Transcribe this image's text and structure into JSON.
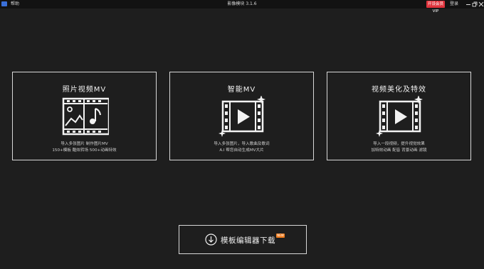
{
  "titlebar": {
    "menu_help": "帮助",
    "app_title": "影像模块 3.1.6",
    "upgrade_label": "开设会员VIP",
    "login_label": "登录"
  },
  "cards": [
    {
      "title": "照片视频MV",
      "desc1": "导入多张图片 制作图片MV",
      "desc2": "150+模板 酷炫转场 500+动画特效",
      "icon": "photo-music-icon"
    },
    {
      "title": "智能MV",
      "desc1": "导入多张图片，导入歌曲及歌词",
      "desc2": "A.I 帮您自动生成MV大片",
      "icon": "video-play-sparkle-icon"
    },
    {
      "title": "视频美化及特效",
      "desc1": "导入一段视频，提升视觉效果",
      "desc2": "加特效动画 配音 背景动画 滤镜",
      "icon": "video-play-sparkle-icon"
    }
  ],
  "download": {
    "label": "模板编辑器下载",
    "badge": "NEW"
  }
}
